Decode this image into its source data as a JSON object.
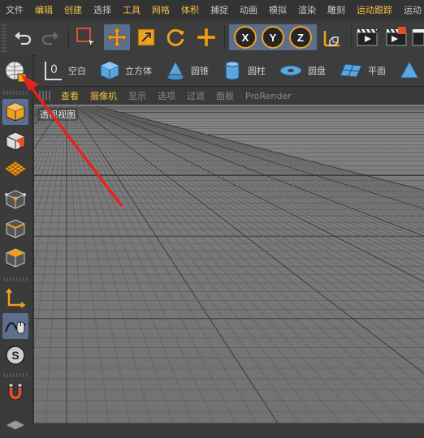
{
  "menu": [
    {
      "label": "文件",
      "highlight": false
    },
    {
      "label": "编辑",
      "highlight": true
    },
    {
      "label": "创建",
      "highlight": true
    },
    {
      "label": "选择",
      "highlight": false
    },
    {
      "label": "工具",
      "highlight": true
    },
    {
      "label": "网格",
      "highlight": true
    },
    {
      "label": "体积",
      "highlight": true
    },
    {
      "label": "捕捉",
      "highlight": false
    },
    {
      "label": "动画",
      "highlight": false
    },
    {
      "label": "模拟",
      "highlight": false
    },
    {
      "label": "渲染",
      "highlight": false
    },
    {
      "label": "雕刻",
      "highlight": false
    },
    {
      "label": "运动跟踪",
      "highlight": true
    },
    {
      "label": "运动",
      "highlight": false
    }
  ],
  "toolbar": {
    "axis_x": "X",
    "axis_y": "Y",
    "axis_z": "Z"
  },
  "objects": {
    "null": "空白",
    "cube": "立方体",
    "cone": "圆锥",
    "cylinder": "圆柱",
    "disc": "圆盘",
    "plane": "平面"
  },
  "view_menu": [
    "查看",
    "摄像机",
    "显示",
    "选项",
    "过滤",
    "面板",
    "ProRender"
  ],
  "viewport": {
    "label": "透视视图"
  },
  "colors": {
    "accent": "#f0a020",
    "selected": "#5b6f8c",
    "annotation": "#e8231c"
  }
}
